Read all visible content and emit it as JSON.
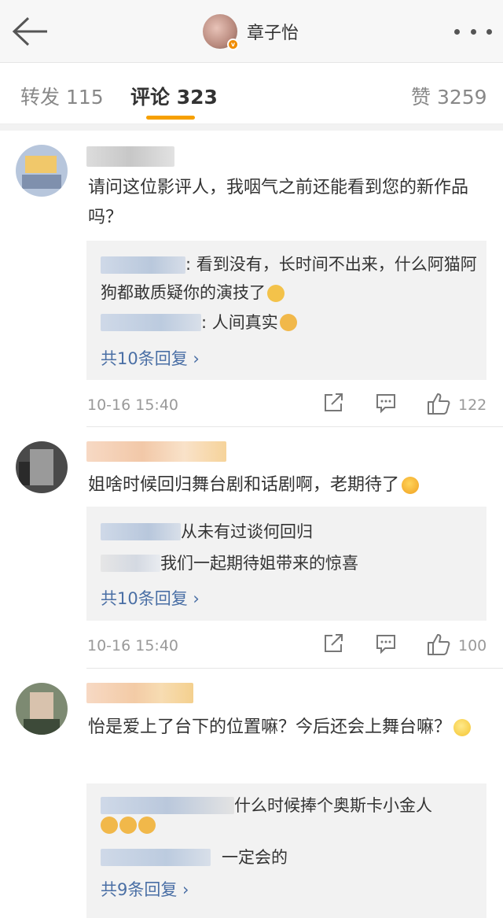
{
  "header": {
    "title": "章子怡",
    "verified_mark": "v"
  },
  "tabs": [
    {
      "label": "转发 115"
    },
    {
      "label": "评论 323"
    },
    {
      "label": "赞 3259"
    }
  ],
  "comments": [
    {
      "text": "请问这位影评人，我咽气之前还能看到您的新作品吗？",
      "replies": [
        {
          "text": ": 看到没有，长时间不出来，什么阿猫阿狗都敢质疑你的演技了"
        },
        {
          "text": ": 人间真实"
        }
      ],
      "more_replies": "共10条回复 ›",
      "time": "10-16 15:40",
      "likes": "122"
    },
    {
      "text": "姐啥时候回归舞台剧和话剧啊，老期待了",
      "replies": [
        {
          "text": "从未有过谈何回归"
        },
        {
          "text": "我们一起期待姐带来的惊喜"
        }
      ],
      "more_replies": "共10条回复 ›",
      "time": "10-16 15:40",
      "likes": "100"
    },
    {
      "text": "怡是爱上了台下的位置嘛？今后还会上舞台嘛？",
      "replies": [
        {
          "text": "什么时候捧个奥斯卡小金人"
        },
        {
          "text": "一定会的"
        }
      ],
      "more_replies": "共9条回复 ›"
    }
  ],
  "colors": {
    "accent": "#f6a000",
    "link": "#4a6fa5",
    "muted": "#999999"
  },
  "icons": [
    "back-arrow-icon",
    "more-dots-icon",
    "share-icon",
    "comment-icon",
    "thumbs-up-icon",
    "emoji-icon"
  ]
}
